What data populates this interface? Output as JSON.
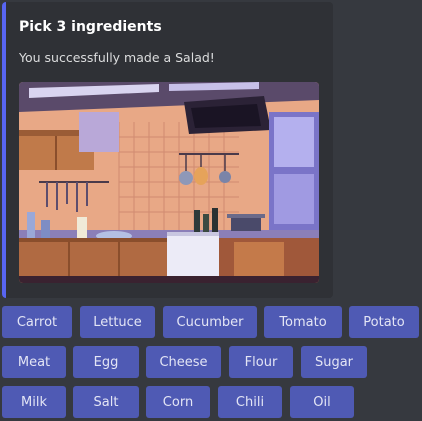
{
  "embed": {
    "title": "Pick 3 ingredients",
    "description": "You successfully made a Salad!",
    "accent_color": "#5865f2",
    "image_alt": "pixel-art kitchen illustration"
  },
  "buttons": {
    "row1": [
      "Carrot",
      "Lettuce",
      "Cucumber",
      "Tomato",
      "Potato"
    ],
    "row2": [
      "Meat",
      "Egg",
      "Cheese",
      "Flour",
      "Sugar"
    ],
    "row3": [
      "Milk",
      "Salt",
      "Corn",
      "Chili",
      "Oil"
    ],
    "color": "#4f5ab4"
  }
}
